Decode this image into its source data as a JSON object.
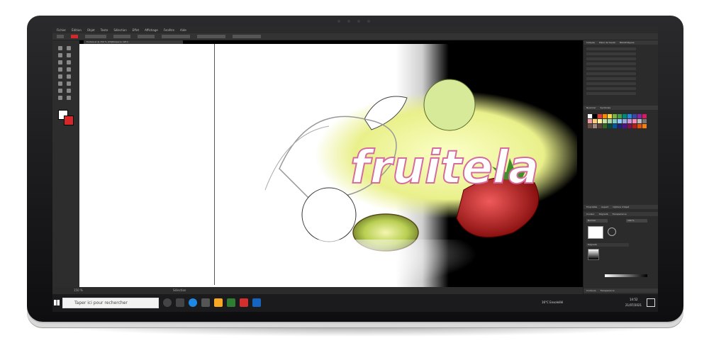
{
  "app": {
    "menu": [
      "Fichier",
      "Édition",
      "Objet",
      "Texte",
      "Sélection",
      "Effet",
      "Affichage",
      "Fenêtre",
      "Aide"
    ],
    "tab_title": "fruitela.ai @ 150 % (CMJN/Aperçu GPU)",
    "status_zoom": "150 %",
    "status_tool": "Sélection"
  },
  "artwork": {
    "logo_text": "fruitela"
  },
  "panels": {
    "layers_tabs": [
      "Calques",
      "Plans de travail",
      "Bibliothèques"
    ],
    "swatches_tabs": [
      "Nuancier",
      "Symboles"
    ],
    "properties_tabs": [
      "Propriétés",
      "Aspect",
      "Options d'objet"
    ],
    "color_tabs": [
      "Couleur",
      "Dégradé",
      "Transparence"
    ],
    "blend_mode": "Normal",
    "opacity": "100 %",
    "gradient_label": "Dégradé",
    "bottom_tabs": [
      "Contours",
      "Transparence"
    ]
  },
  "taskbar": {
    "search_placeholder": "Taper ici pour rechercher",
    "weather": "16°C Ensoleillé",
    "time": "14:52",
    "date": "21/07/2021"
  },
  "colors": {
    "accent_red": "#d62828",
    "leaf_green": "#3f8f2a",
    "logo_glow": "#e9f08a"
  }
}
